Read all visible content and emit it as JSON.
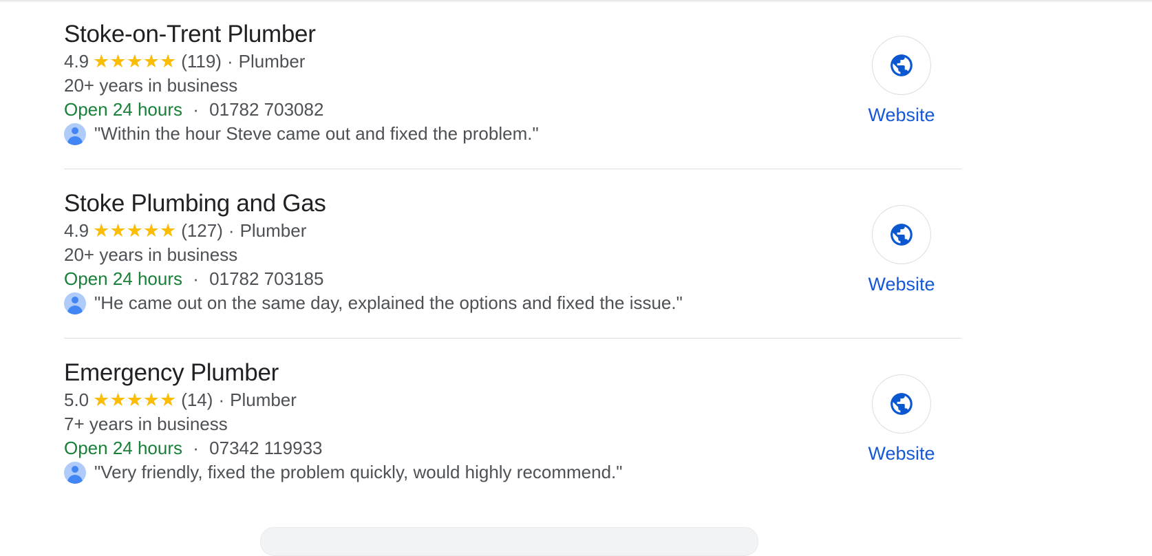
{
  "listings": [
    {
      "name": "Stoke-on-Trent Plumber",
      "rating": "4.9",
      "stars": "★★★★★",
      "reviews": "(119)",
      "category": "Plumber",
      "years": "20+ years in business",
      "hours": "Open 24 hours",
      "phone": "01782 703082",
      "review": "\"Within the hour Steve came out and fixed the problem.\"",
      "website_label": "Website"
    },
    {
      "name": "Stoke Plumbing and Gas",
      "rating": "4.9",
      "stars": "★★★★★",
      "reviews": "(127)",
      "category": "Plumber",
      "years": "20+ years in business",
      "hours": "Open 24 hours",
      "phone": "01782 703185",
      "review": "\"He came out on the same day, explained the options and fixed the issue.\"",
      "website_label": "Website"
    },
    {
      "name": "Emergency Plumber",
      "rating": "5.0",
      "stars": "★★★★★",
      "reviews": "(14)",
      "category": "Plumber",
      "years": "7+ years in business",
      "hours": "Open 24 hours",
      "phone": "07342 119933",
      "review": "\"Very friendly, fixed the problem quickly, would highly recommend.\"",
      "website_label": "Website"
    }
  ],
  "separator": "·",
  "icons": {
    "website": "globe-icon",
    "reviewer": "avatar-icon",
    "rating": "star-icon"
  },
  "colors": {
    "open": "#188038",
    "link": "#1558d6",
    "stars": "#fbbc04",
    "globe": "#0b57d0"
  }
}
